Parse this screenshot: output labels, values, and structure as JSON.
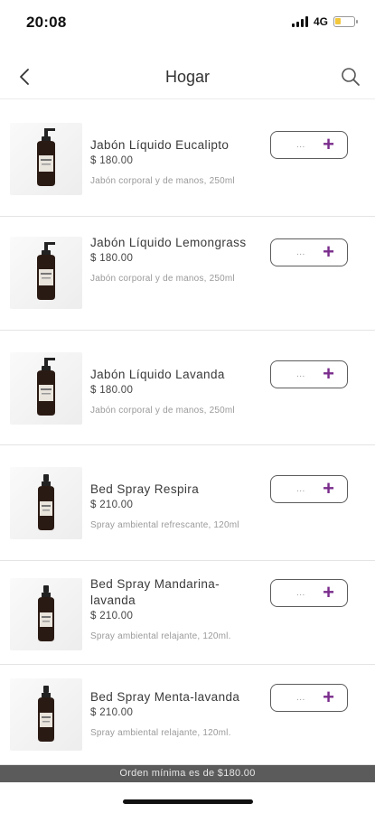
{
  "status_bar": {
    "time": "20:08",
    "network": "4G"
  },
  "header": {
    "title": "Hogar",
    "back_icon": "chevron-left-icon",
    "search_icon": "search-icon"
  },
  "products": [
    {
      "name": "Jabón Líquido Eucalipto",
      "price": "$ 180.00",
      "desc": "Jabón corporal y de manos, 250ml",
      "qty": "...",
      "plus": "+",
      "bottle": "pump"
    },
    {
      "name": "Jabón Líquido Lemongrass",
      "price": "$ 180.00",
      "desc": "Jabón corporal y de manos, 250ml",
      "qty": "...",
      "plus": "+",
      "bottle": "pump"
    },
    {
      "name": "Jabón Líquido Lavanda",
      "price": "$ 180.00",
      "desc": "Jabón corporal y de manos, 250ml",
      "qty": "...",
      "plus": "+",
      "bottle": "pump"
    },
    {
      "name": "Bed Spray Respira",
      "price": "$ 210.00",
      "desc": "Spray ambiental refrescante, 120ml",
      "qty": "...",
      "plus": "+",
      "bottle": "spray"
    },
    {
      "name": "Bed Spray Mandarina-lavanda",
      "price": "$ 210.00",
      "desc": "Spray ambiental relajante, 120ml.",
      "qty": "...",
      "plus": "+",
      "bottle": "spray"
    },
    {
      "name": "Bed Spray Menta-lavanda",
      "price": "$ 210.00",
      "desc": "Spray ambiental relajante, 120ml.",
      "qty": "...",
      "plus": "+",
      "bottle": "spray"
    }
  ],
  "footer": {
    "min_order": "Orden mínima es de $180.00"
  },
  "colors": {
    "accent": "#7a2c8c",
    "banner": "#5b5b5b",
    "battery": "#f2c73b"
  }
}
